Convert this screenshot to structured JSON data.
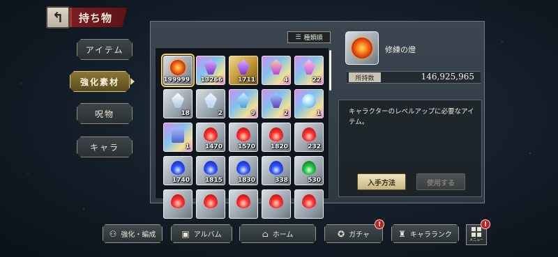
{
  "header": {
    "back_icon": "back-arrow-icon",
    "title": "持ち物"
  },
  "tabs": [
    {
      "label": "アイテム",
      "active": false
    },
    {
      "label": "強化素材",
      "active": true
    },
    {
      "label": "呪物",
      "active": false
    },
    {
      "label": "キャラ",
      "active": false
    }
  ],
  "sort": {
    "icon": "sort-icon",
    "label": "種類順"
  },
  "items": [
    {
      "count": "199999",
      "rarity": "silver",
      "kind": "orb",
      "selected": true
    },
    {
      "count": "13266",
      "rarity": "rainbow",
      "kind": "crystal-violet"
    },
    {
      "count": "1711",
      "rarity": "gold",
      "kind": "crystal-violet"
    },
    {
      "count": "4",
      "rarity": "rainbow",
      "kind": "crystal-fire"
    },
    {
      "count": "22",
      "rarity": "rainbow",
      "kind": "crystal-pink"
    },
    {
      "count": "18",
      "rarity": "silver",
      "kind": "crystal-white"
    },
    {
      "count": "2",
      "rarity": "silver",
      "kind": "crystal-pearl"
    },
    {
      "count": "9",
      "rarity": "rainbow",
      "kind": "crystal-blue"
    },
    {
      "count": "2",
      "rarity": "rainbow",
      "kind": "altar"
    },
    {
      "count": "1",
      "rarity": "rainbow",
      "kind": "globe"
    },
    {
      "count": "1",
      "rarity": "rainbow",
      "kind": "book"
    },
    {
      "count": "1470",
      "rarity": "silver",
      "kind": "flame-red"
    },
    {
      "count": "1570",
      "rarity": "silver",
      "kind": "flame-red"
    },
    {
      "count": "1820",
      "rarity": "silver",
      "kind": "flame-red"
    },
    {
      "count": "232",
      "rarity": "silver",
      "kind": "flame-red"
    },
    {
      "count": "1740",
      "rarity": "silver",
      "kind": "flame-blue"
    },
    {
      "count": "1815",
      "rarity": "silver",
      "kind": "flame-blue"
    },
    {
      "count": "1830",
      "rarity": "silver",
      "kind": "flame-blue"
    },
    {
      "count": "338",
      "rarity": "silver",
      "kind": "flame-blue"
    },
    {
      "count": "530",
      "rarity": "silver",
      "kind": "flame-green"
    },
    {
      "count": "",
      "rarity": "silver",
      "kind": "flame-red"
    },
    {
      "count": "",
      "rarity": "silver",
      "kind": "flame-red"
    },
    {
      "count": "",
      "rarity": "silver",
      "kind": "flame-red"
    },
    {
      "count": "",
      "rarity": "silver",
      "kind": "flame-red"
    },
    {
      "count": "",
      "rarity": "silver",
      "kind": "flame-red"
    }
  ],
  "detail": {
    "name": "修練の燈",
    "owned_label": "所持数",
    "owned_value": "146,925,965",
    "description": "キャラクターのレベルアップに必要なアイテム。",
    "get_button": "入手方法",
    "use_button": "使用する"
  },
  "nav": [
    {
      "label": "強化・編成",
      "icon": "people-icon",
      "badge": false
    },
    {
      "label": "アルバム",
      "icon": "album-icon",
      "badge": false
    },
    {
      "label": "ホーム",
      "icon": "home-icon",
      "badge": false
    },
    {
      "label": "ガチャ",
      "icon": "gacha-icon",
      "badge": true
    },
    {
      "label": "キャラランク",
      "icon": "rank-icon",
      "badge": false
    }
  ],
  "menu": {
    "label": "メニュー",
    "icon": "menu-grid-icon",
    "badge": true
  },
  "badge_mark": "!",
  "colors": {
    "title_banner": "#7a1e22",
    "active_tab": "#8a7638",
    "badge": "#c21f1f",
    "selected_outline": "#ffd24a"
  }
}
